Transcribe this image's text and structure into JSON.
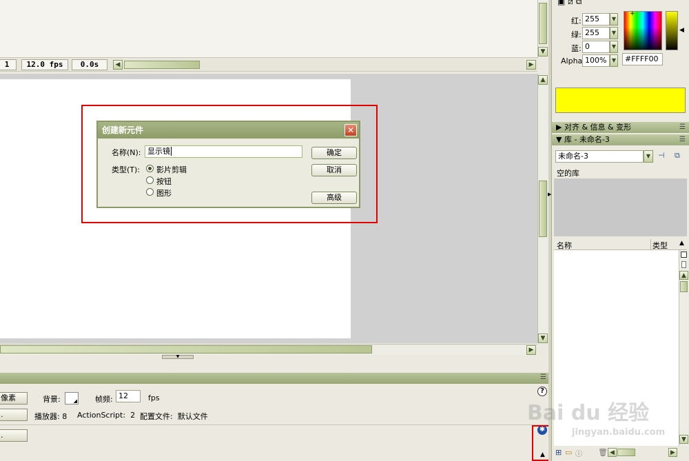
{
  "timeline": {
    "frame": "1",
    "fps": "12.0 fps",
    "time": "0.0s"
  },
  "dialog": {
    "title": "创建新元件",
    "name_label": "名称(N):",
    "name_value": "显示镜",
    "type_label": "类型(T):",
    "types": [
      "影片剪辑",
      "按钮",
      "图形"
    ],
    "selected_type": "影片剪辑",
    "ok": "确定",
    "cancel": "取消",
    "advanced": "高级",
    "close": "✕"
  },
  "properties": {
    "size_btn": "像素",
    "bg_label": "背景:",
    "fps_label": "帧频:",
    "fps_value": "12",
    "fps_unit": "fps",
    "player_label": "播放器:",
    "player_value": "8",
    "as_label": "ActionScript:",
    "as_value": "2",
    "profile_label": "配置文件:",
    "profile_value": "默认文件",
    "help": "?"
  },
  "color_mixer": {
    "red_label": "红:",
    "red": "255",
    "green_label": "绿:",
    "green": "255",
    "blue_label": "蓝:",
    "blue": "0",
    "alpha_label": "Alpha:",
    "alpha": "100%",
    "hex": "#FFFF00",
    "swatch": "#FFFF00"
  },
  "panels": {
    "align_info": "▶ 对齐 & 信息 & 变形",
    "library_title": "▼ 库 - 未命名-3",
    "library_doc": "未命名-3",
    "empty_library": "空的库",
    "col_name": "名称",
    "col_type": "类型"
  },
  "watermark": {
    "brand": "Bai du 经验",
    "url": "jingyan.baidu.com"
  }
}
